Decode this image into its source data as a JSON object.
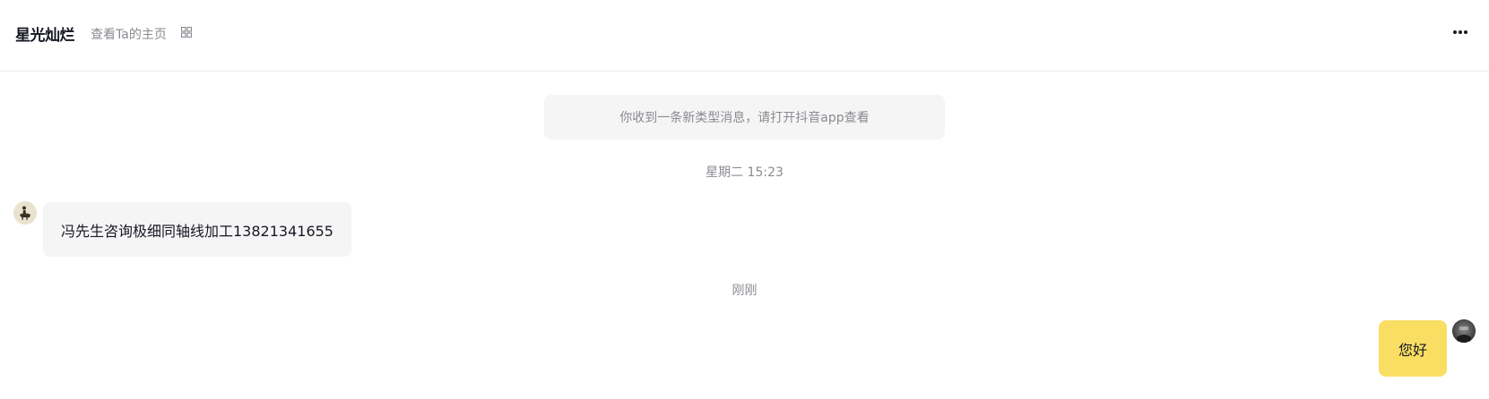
{
  "header": {
    "contact_name": "星光灿烂",
    "profile_link": "查看Ta的主页",
    "qr_icon": "qr-code-icon",
    "more_icon": "more-dots-icon"
  },
  "messages": {
    "system_notice": "你收到一条新类型消息，请打开抖音app查看",
    "timestamp_1": "星期二 15:23",
    "incoming_text": "冯先生咨询极细同轴线加工13821341655",
    "timestamp_2": "刚刚",
    "outgoing_text": "您好"
  },
  "colors": {
    "outgoing_bubble": "#fade64",
    "incoming_bubble": "#f5f5f5",
    "muted_text": "#8a8b91"
  }
}
